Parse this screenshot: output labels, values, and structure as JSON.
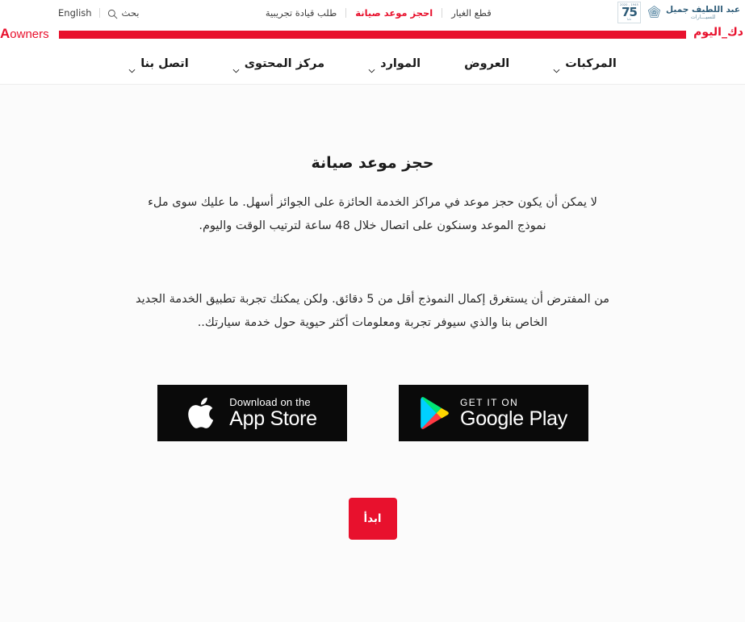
{
  "header": {
    "brand": {
      "name_ar": "عبد اللطيف جميل",
      "subtitle_ar": "للسيـــارات",
      "anniversary_number": "75",
      "anniversary_dates": "1945 - 2020",
      "anniversary_sub": "عاماً"
    },
    "top_nav": [
      {
        "label": "قطع الغيار",
        "accent": false
      },
      {
        "label": "احجز موعد صيانة",
        "accent": true
      },
      {
        "label": "طلب قيادة تجريبية",
        "accent": false
      }
    ],
    "language_toggle": "English",
    "search_label": "بحث",
    "search_icon": "search-icon"
  },
  "marquee": {
    "text_right": "دك_اليوم",
    "text_left_bold": "A",
    "text_left_rest": "owners",
    "bar_color": "#e8112d"
  },
  "main_nav": [
    {
      "label": "المركبات",
      "has_chevron": true
    },
    {
      "label": "العروض",
      "has_chevron": false
    },
    {
      "label": "الموارد",
      "has_chevron": true
    },
    {
      "label": "مركز المحتوى",
      "has_chevron": true
    },
    {
      "label": "اتصل بنا",
      "has_chevron": true
    }
  ],
  "main": {
    "title": "حجز موعد صيانة",
    "paragraph_1": "لا يمكن أن يكون حجز موعد في مراكز الخدمة الحائزة على الجوائز أسهل. ما عليك سوى ملء نموذج الموعد وسنكون على اتصال خلال 48 ساعة لترتيب الوقت واليوم.",
    "paragraph_2": "من المفترض أن يستغرق إكمال النموذج أقل من 5 دقائق. ولكن يمكنك تجربة تطبيق الخدمة الجديد الخاص بنا والذي سيوفر تجربة ومعلومات أكثر حيوية حول خدمة سيارتك..",
    "app_store": {
      "small_text": "Download on the",
      "big_text": "App Store",
      "icon": "apple-icon"
    },
    "google_play": {
      "small_text": "GET IT ON",
      "big_text": "Google Play",
      "icon": "google-play-icon"
    },
    "start_button": "ابدأ"
  },
  "colors": {
    "accent_red": "#e8112d",
    "brand_blue": "#2e5c78",
    "page_bg": "#fbfbfb",
    "header_bg": "#ffffff"
  }
}
